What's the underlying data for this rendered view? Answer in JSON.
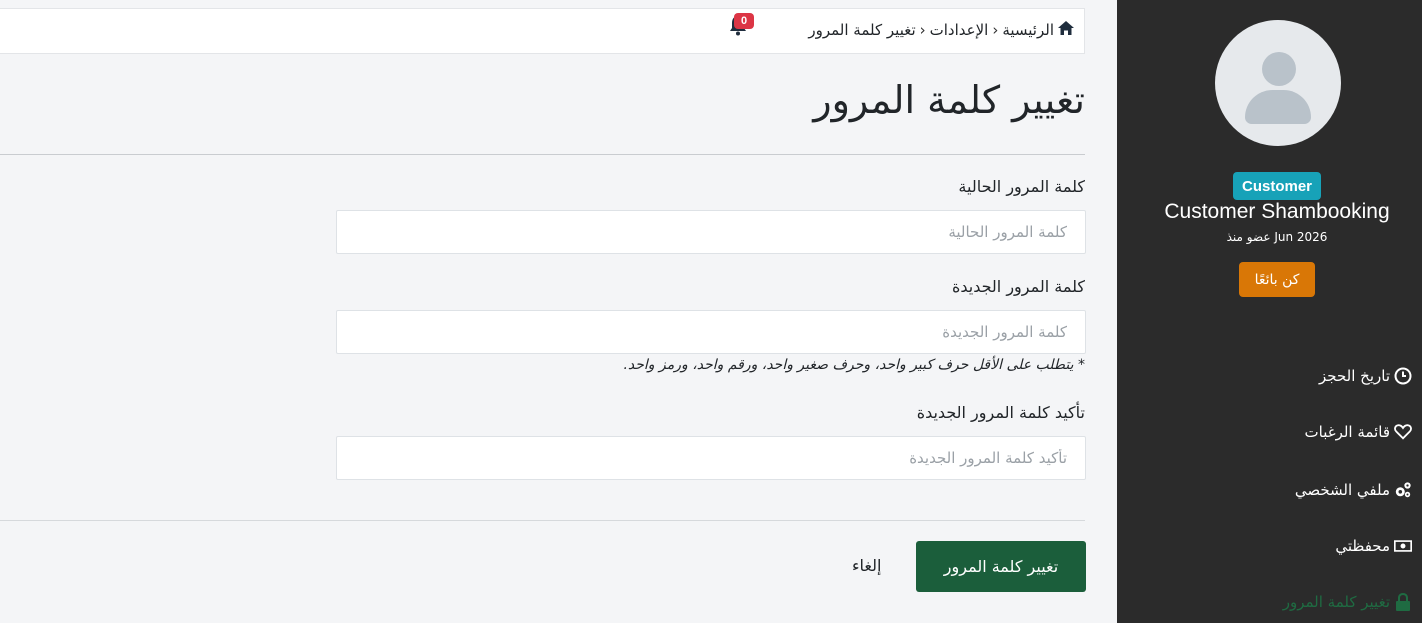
{
  "breadcrumb": {
    "home": "الرئيسية",
    "settings": "الإعدادات",
    "current": "تغيير كلمة المرور"
  },
  "notifications": {
    "count": "0"
  },
  "page": {
    "title": "تغيير كلمة المرور"
  },
  "form": {
    "current_password": {
      "label": "كلمة المرور الحالية",
      "placeholder": "كلمة المرور الحالية",
      "value": ""
    },
    "new_password": {
      "label": "كلمة المرور الجديدة",
      "placeholder": "كلمة المرور الجديدة",
      "value": ""
    },
    "password_hint": "* يتطلب على الأقل حرف كبير واحد، وحرف صغير واحد، ورقم واحد، ورمز واحد.",
    "confirm_password": {
      "label": "تأكيد كلمة المرور الجديدة",
      "placeholder": "تأكيد كلمة المرور الجديدة",
      "value": ""
    },
    "submit_label": "تغيير كلمة المرور",
    "cancel_label": "إلغاء"
  },
  "profile": {
    "role": "Customer",
    "name": "Customer Shambooking",
    "member_since": "عضو منذ Jun 2026",
    "become_seller": "كن بائعًا"
  },
  "menu": [
    {
      "label": "تاريخ الحجز",
      "icon": "clock-icon"
    },
    {
      "label": "قائمة الرغبات",
      "icon": "heart-icon"
    },
    {
      "label": "ملفي الشخصي",
      "icon": "gears-icon"
    },
    {
      "label": "محفظتي",
      "icon": "money-icon"
    },
    {
      "label": "تغيير كلمة المرور",
      "icon": "lock-icon",
      "active": true
    }
  ],
  "colors": {
    "sidebar_bg": "#2b2b2b",
    "primary_button": "#1b5e3b",
    "seller_button": "#d97706",
    "role_badge": "#17a2b8",
    "notification_badge": "#dc3545",
    "active_menu": "#1f6b42"
  }
}
